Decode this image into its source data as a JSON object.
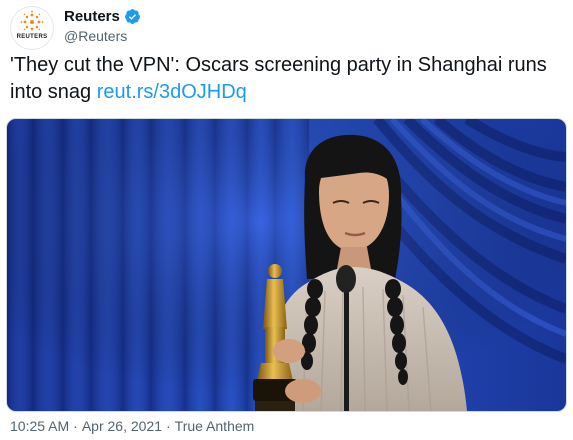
{
  "tweet": {
    "author": {
      "name": "Reuters",
      "handle": "@Reuters",
      "verified": true,
      "avatar_icon": "reuters-logo-icon",
      "avatar_text": "REUTERS"
    },
    "text": "'They cut the VPN': Oscars screening party in Shanghai runs into snag ",
    "link": "reut.rs/3dOJHDq",
    "media": {
      "description_icon": "photo-image"
    },
    "footer": {
      "time": "10:25 AM",
      "sep1": "·",
      "date": "Apr 26, 2021",
      "sep2": "·",
      "source": "True Anthem"
    }
  },
  "colors": {
    "link": "#1d9bf0",
    "verified": "#1d9bf0",
    "secondary_text": "#536471",
    "curtain_blue": "#1e3fa8",
    "reuters_orange": "#f08a18"
  }
}
